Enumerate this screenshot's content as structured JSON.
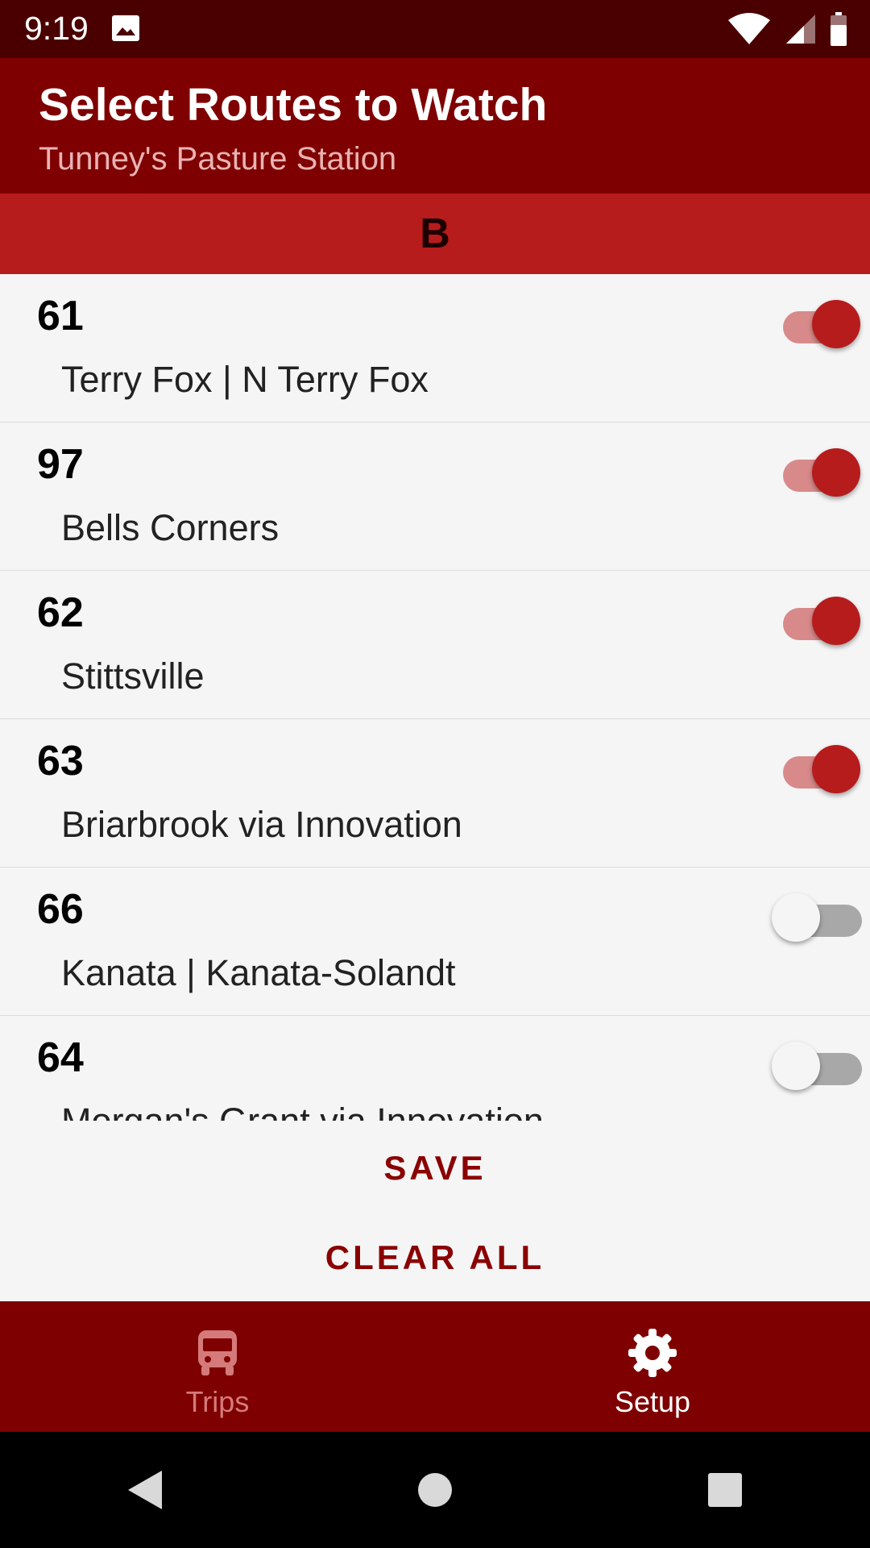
{
  "status_bar": {
    "time": "9:19"
  },
  "app_bar": {
    "title": "Select Routes to Watch",
    "subtitle": "Tunney's Pasture Station"
  },
  "section": {
    "label": "B"
  },
  "routes": [
    {
      "number": "61",
      "name": "Terry Fox | N Terry Fox",
      "watched": true
    },
    {
      "number": "97",
      "name": "Bells Corners",
      "watched": true
    },
    {
      "number": "62",
      "name": "Stittsville",
      "watched": true
    },
    {
      "number": "63",
      "name": "Briarbrook via Innovation",
      "watched": true
    },
    {
      "number": "66",
      "name": "Kanata | Kanata-Solandt",
      "watched": false
    },
    {
      "number": "64",
      "name": "Morgan's Grant via Innovation",
      "watched": false
    }
  ],
  "actions": {
    "save_label": "SAVE",
    "clear_label": "CLEAR ALL"
  },
  "bottom_nav": {
    "items": [
      {
        "label": "Trips",
        "icon": "bus-icon",
        "active": false
      },
      {
        "label": "Setup",
        "icon": "gear-icon",
        "active": true
      }
    ]
  },
  "colors": {
    "primary_dark": "#7f0000",
    "accent": "#b71c1c",
    "status_bar": "#4b0000"
  }
}
